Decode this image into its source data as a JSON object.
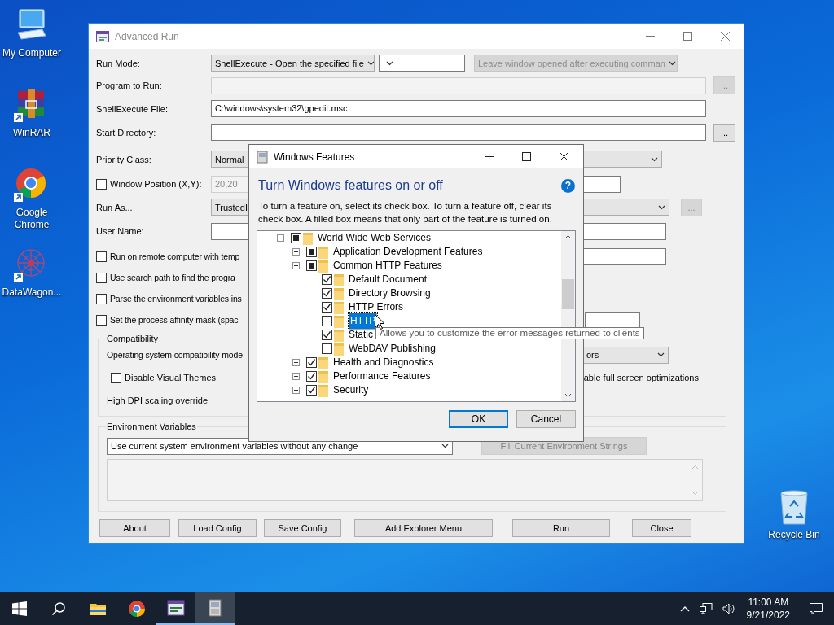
{
  "desktop_icons": [
    {
      "label": "My Computer",
      "kind": "computer",
      "shortcut": false
    },
    {
      "label": "WinRAR",
      "kind": "archive",
      "shortcut": true
    },
    {
      "label": "Google Chrome",
      "kind": "browser",
      "shortcut": true
    },
    {
      "label": "DataWagon...",
      "kind": "burst",
      "shortcut": true
    }
  ],
  "recycle_bin": {
    "label": "Recycle Bin"
  },
  "advanced_run": {
    "title": "Advanced Run",
    "run_mode": {
      "label": "Run Mode:",
      "value": "ShellExecute - Open the specified file",
      "option": {
        "text": "Leave window opened after executing comman",
        "disabled": true
      }
    },
    "program": {
      "label": "Program to Run:",
      "disabled": true,
      "browse": "...",
      "browse_disabled": true
    },
    "shell_file": {
      "label": "ShellExecute File:",
      "value": "C:\\windows\\system32\\gpedit.msc"
    },
    "start_dir": {
      "label": "Start Directory:",
      "browse": "...",
      "browse_disabled": false
    },
    "priority": {
      "label": "Priority Class:",
      "value": "Normal"
    },
    "window_position": {
      "label": "Window Position (X,Y):",
      "checked": false,
      "value": "20,20",
      "disabled": true
    },
    "run_as": {
      "label": "Run As...",
      "value": "TrustedI",
      "browse": "...",
      "browse_disabled": true
    },
    "user_name": {
      "label": "User Name:"
    },
    "options": [
      {
        "label": "Run on remote computer with temp",
        "checked": false
      },
      {
        "label": "Use search path to find the progra",
        "checked": false
      },
      {
        "label": "Parse the environment variables ins",
        "checked": false
      },
      {
        "label": "Set the process affinity mask (spac",
        "checked": false
      }
    ],
    "compatibility": {
      "title": "Compatibility",
      "os_label": "Operating system compatibility mode",
      "os_value": "ors",
      "disable_themes": {
        "label": "Disable Visual Themes",
        "checked": false
      },
      "fullscreen_label": "able full screen optimizations",
      "dpi_label": "High DPI scaling override:"
    },
    "environment": {
      "title": "Environment Variables",
      "value": "Use current system environment variables without any change",
      "fill_button": {
        "label": "Fill Current Environment Strings",
        "disabled": true
      }
    },
    "buttons": [
      "About",
      "Load Config",
      "Save Config",
      "Add Explorer Menu",
      "Run",
      "Close"
    ]
  },
  "features_dialog": {
    "title": "Windows Features",
    "heading": "Turn Windows features on or off",
    "help": "?",
    "description": "To turn a feature on, select its check box. To turn a feature off, clear its check box. A filled box means that only part of the feature is turned on.",
    "tree": [
      {
        "label": "World Wide Web Services",
        "partial": true,
        "expanded": true,
        "selected": false,
        "children": [
          {
            "label": "Application Development Features",
            "partial": true,
            "expanded": false,
            "selected": false
          },
          {
            "label": "Common HTTP Features",
            "partial": true,
            "expanded": true,
            "selected": false,
            "children": [
              {
                "label": "Default Document",
                "checked": true,
                "selected": false
              },
              {
                "label": "Directory Browsing",
                "checked": true,
                "selected": false
              },
              {
                "label": "HTTP Errors",
                "checked": true,
                "selected": false
              },
              {
                "label": "HTTP",
                "checked": false,
                "selected": true
              },
              {
                "label": "Static",
                "checked": true,
                "selected": false
              },
              {
                "label": "WebDAV Publishing",
                "checked": false,
                "selected": false
              }
            ]
          },
          {
            "label": "Health and Diagnostics",
            "checked": true,
            "expanded": false,
            "selected": false
          },
          {
            "label": "Performance Features",
            "checked": true,
            "expanded": false,
            "selected": false
          },
          {
            "label": "Security",
            "checked": true,
            "expanded": false,
            "selected": false
          }
        ]
      }
    ],
    "tooltip": "Allows you to customize the error messages returned to clients",
    "buttons": [
      {
        "label": "OK",
        "default": true
      },
      {
        "label": "Cancel",
        "default": false
      }
    ]
  },
  "taskbar": {
    "apps": [
      {
        "kind": "folder",
        "running": false,
        "selected": false
      },
      {
        "kind": "browser",
        "running": false,
        "selected": false
      },
      {
        "kind": "runner",
        "running": true,
        "selected": false
      },
      {
        "kind": "features",
        "running": true,
        "selected": true
      }
    ],
    "time": "11:00 AM",
    "date": "9/21/2022"
  }
}
